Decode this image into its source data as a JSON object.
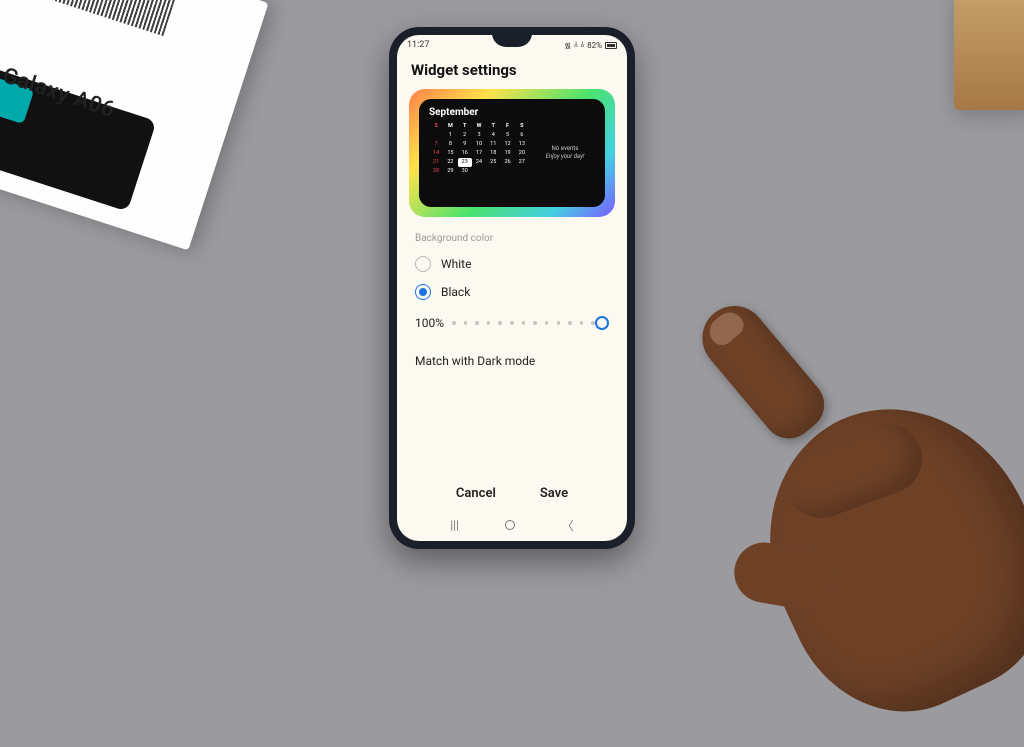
{
  "desk": {
    "product_box_name": "Galaxy A06"
  },
  "status": {
    "time": "11:27",
    "battery_pct": "82%"
  },
  "page": {
    "title": "Widget settings"
  },
  "widget_preview": {
    "month_label": "September",
    "days_header": [
      "S",
      "M",
      "T",
      "W",
      "T",
      "F",
      "S"
    ],
    "rows": [
      [
        "",
        "1",
        "2",
        "3",
        "4",
        "5",
        "6"
      ],
      [
        "7",
        "8",
        "9",
        "10",
        "11",
        "12",
        "13"
      ],
      [
        "14",
        "15",
        "16",
        "17",
        "18",
        "19",
        "20"
      ],
      [
        "21",
        "22",
        "23",
        "24",
        "25",
        "26",
        "27"
      ],
      [
        "28",
        "29",
        "30",
        "",
        "",
        "",
        ""
      ]
    ],
    "today_date": "23",
    "events_title": "No events",
    "events_sub": "Enjoy your day!"
  },
  "background": {
    "section_label": "Background color",
    "options": {
      "white": "White",
      "black": "Black"
    },
    "selected": "black",
    "opacity_pct": "100%"
  },
  "darkmode": {
    "label": "Match with Dark mode"
  },
  "actions": {
    "cancel": "Cancel",
    "save": "Save"
  }
}
